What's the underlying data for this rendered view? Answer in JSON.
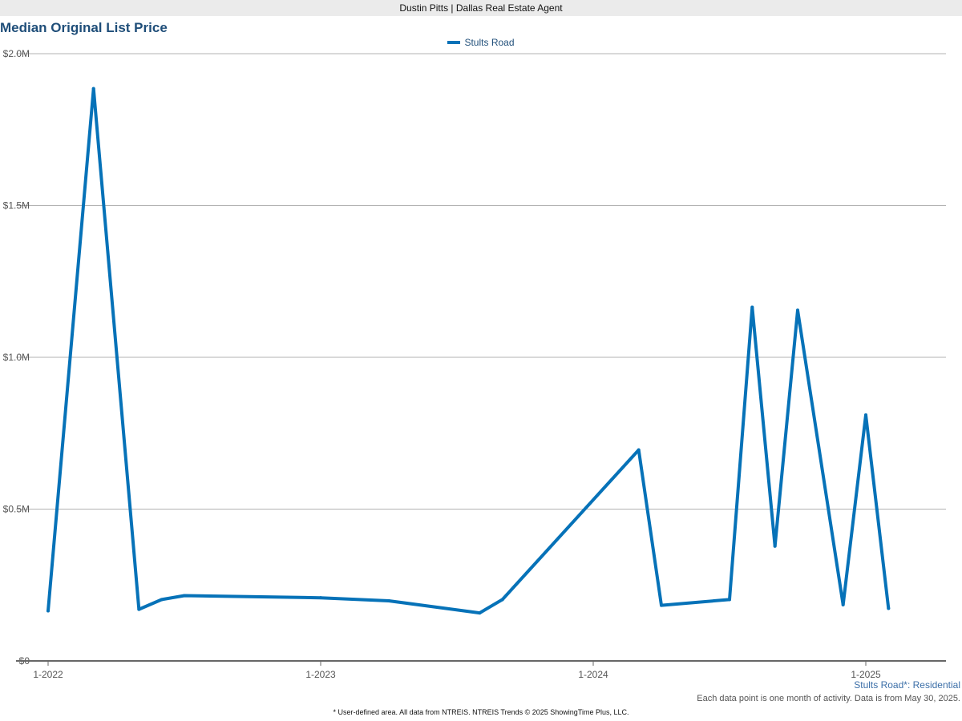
{
  "header": {
    "agent": "Dustin Pitts | Dallas Real Estate Agent"
  },
  "chart_data": {
    "type": "line",
    "title": "Median Original List Price",
    "xlabel": "",
    "ylabel": "",
    "ylim": [
      0,
      2000000
    ],
    "yticks": [
      {
        "value": 0,
        "label": "$0"
      },
      {
        "value": 500000,
        "label": "$0.5M"
      },
      {
        "value": 1000000,
        "label": "$1.0M"
      },
      {
        "value": 1500000,
        "label": "$1.5M"
      },
      {
        "value": 2000000,
        "label": "$2.0M"
      }
    ],
    "xlim": [
      "2022-01",
      "2025-04"
    ],
    "xticks": [
      {
        "value": "2022-01",
        "label": "1-2022"
      },
      {
        "value": "2023-01",
        "label": "1-2023"
      },
      {
        "value": "2024-01",
        "label": "1-2024"
      },
      {
        "value": "2025-01",
        "label": "1-2025"
      }
    ],
    "grid": true,
    "legend_position": "top-center",
    "series": [
      {
        "name": "Stults Road",
        "color": "#0672b8",
        "points": [
          {
            "x": "2022-01",
            "y": 165000
          },
          {
            "x": "2022-03",
            "y": 1885000
          },
          {
            "x": "2022-05",
            "y": 170000
          },
          {
            "x": "2022-06",
            "y": 202000
          },
          {
            "x": "2022-07",
            "y": 215000
          },
          {
            "x": "2023-01",
            "y": 208000
          },
          {
            "x": "2023-04",
            "y": 198000
          },
          {
            "x": "2023-08",
            "y": 158000
          },
          {
            "x": "2023-09",
            "y": 202000
          },
          {
            "x": "2024-03",
            "y": 695000
          },
          {
            "x": "2024-04",
            "y": 183000
          },
          {
            "x": "2024-07",
            "y": 202000
          },
          {
            "x": "2024-08",
            "y": 1165000
          },
          {
            "x": "2024-09",
            "y": 378000
          },
          {
            "x": "2024-10",
            "y": 1155000
          },
          {
            "x": "2024-12",
            "y": 185000
          },
          {
            "x": "2025-01",
            "y": 810000
          },
          {
            "x": "2025-02",
            "y": 173000
          }
        ]
      }
    ]
  },
  "notes": {
    "area": "Stults Road*: Residential",
    "data": "Each data point is one month of activity. Data is from May 30, 2025.",
    "footer": "* User-defined area. All data from NTREIS. NTREIS Trends © 2025 ShowingTime Plus, LLC."
  }
}
